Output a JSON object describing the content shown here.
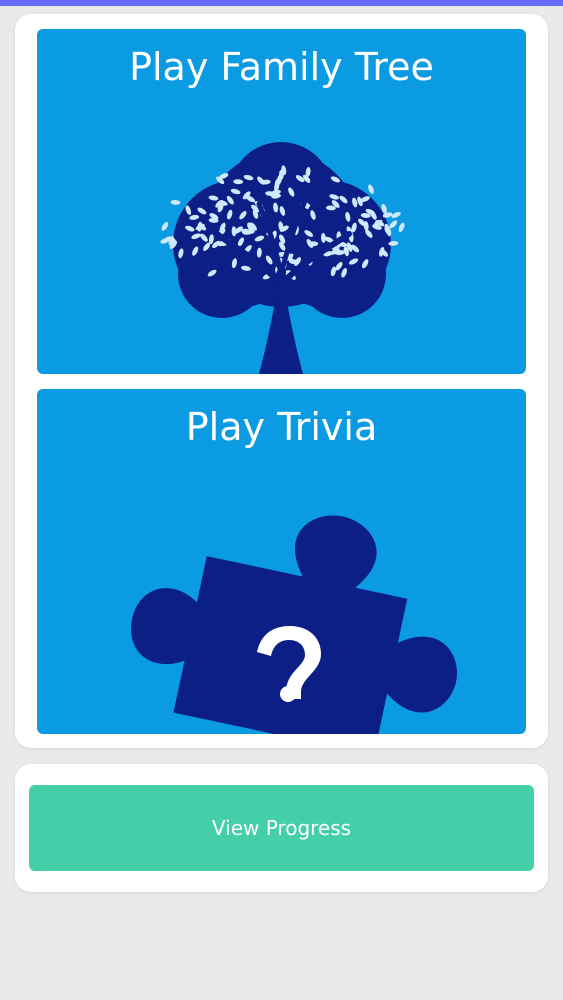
{
  "app": {
    "accent_color": "#6b6cf5",
    "tile_color": "#0a9be2",
    "illustration_color": "#0c1f86",
    "button_color": "#45cfa8"
  },
  "games": [
    {
      "title": "Play Family Tree",
      "icon": "family-tree-icon"
    },
    {
      "title": "Play Trivia",
      "icon": "puzzle-question-icon"
    }
  ],
  "progress": {
    "button_label": "View Progress"
  }
}
